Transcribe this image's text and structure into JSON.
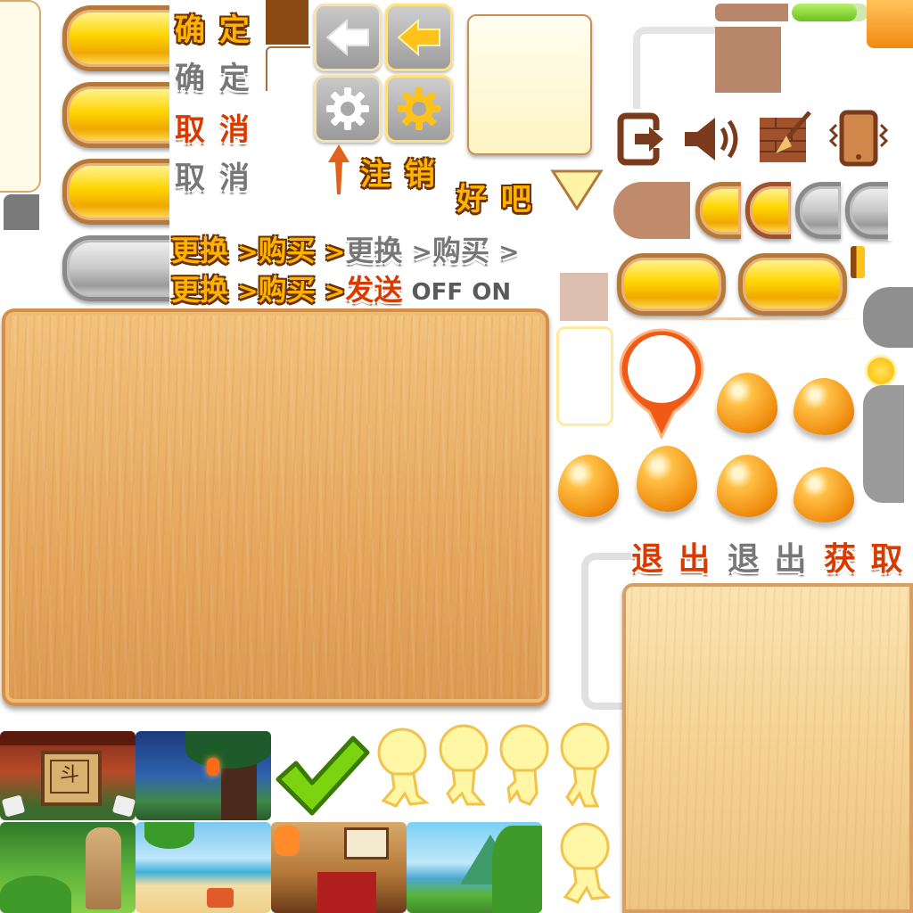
{
  "labels": {
    "confirm_active": "确 定",
    "confirm_disabled": "确 定",
    "cancel_active": "取 消",
    "cancel_disabled": "取 消",
    "logout": "注 销",
    "ok": "好 吧",
    "row1_change": "更换",
    "row1_buy": "购买",
    "row1_change_gray": "更换",
    "row1_buy_gray": "购买",
    "row2_change": "更换",
    "row2_buy": "购买",
    "row2_send": "发送",
    "arrow1": ">",
    "arrow2": ">",
    "arrow3": ">",
    "arrow4": ">",
    "arrow5": ">",
    "arrow6": ">",
    "off": "OFF",
    "on": "ON",
    "exit_active": "退 出",
    "exit_disabled": "退 出",
    "obtain": "获 取"
  },
  "scroll_sign": "斗",
  "progress_fraction": 0.85,
  "colors": {
    "accent_orange": "#ffb300",
    "text_outline": "#6b3200",
    "button_yellow": "#ffd400",
    "icon_brown": "#7a3b1c",
    "progress_green": "#7ed321"
  },
  "icons": [
    "back-arrow-icon",
    "settings-gear-icon",
    "logout-door-icon",
    "speaker-icon",
    "broom-clear-icon",
    "phone-vibrate-icon",
    "checkmark-icon",
    "map-pin-icon",
    "up-arrow-icon"
  ]
}
